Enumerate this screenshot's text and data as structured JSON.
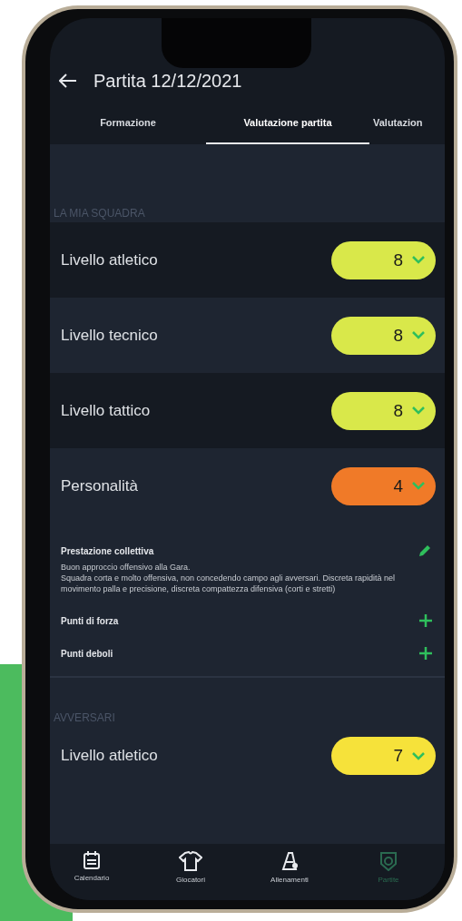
{
  "header": {
    "title": "Partita 12/12/2021"
  },
  "tabs": [
    {
      "label": "Formazione",
      "selected": false
    },
    {
      "label": "Valutazione partita",
      "selected": true
    },
    {
      "label": "Valutazion",
      "selected": false
    }
  ],
  "sections": [
    {
      "title": "LA MIA SQUADRA",
      "ratings": [
        {
          "label": "Livello atletico",
          "value": "8",
          "color": "#d9e84a"
        },
        {
          "label": "Livello tecnico",
          "value": "8",
          "color": "#d9e84a"
        },
        {
          "label": "Livello tattico",
          "value": "8",
          "color": "#d9e84a"
        },
        {
          "label": "Personalità",
          "value": "4",
          "color": "#f07a28"
        }
      ],
      "notes": {
        "title": "Prestazione collettiva",
        "text": "Buon approccio offensivo alla Gara.\nSquadra corta e molto offensiva, non concedendo campo agli avversari. Discreta rapidità nel movimento palla e precisione, discreta compattezza difensiva (corti e stretti)",
        "items": [
          {
            "label": "Punti di forza"
          },
          {
            "label": "Punti deboli"
          }
        ]
      }
    },
    {
      "title": "AVVERSARI",
      "ratings": [
        {
          "label": "Livello atletico",
          "value": "7",
          "color": "#f6e23a"
        }
      ]
    }
  ],
  "nav": [
    {
      "label": "Calendario",
      "kind": "calendar",
      "selected": false
    },
    {
      "label": "Giocatori",
      "kind": "players",
      "selected": false
    },
    {
      "label": "Allenamenti",
      "kind": "training",
      "selected": false
    },
    {
      "label": "Partite",
      "kind": "match",
      "selected": true
    }
  ]
}
